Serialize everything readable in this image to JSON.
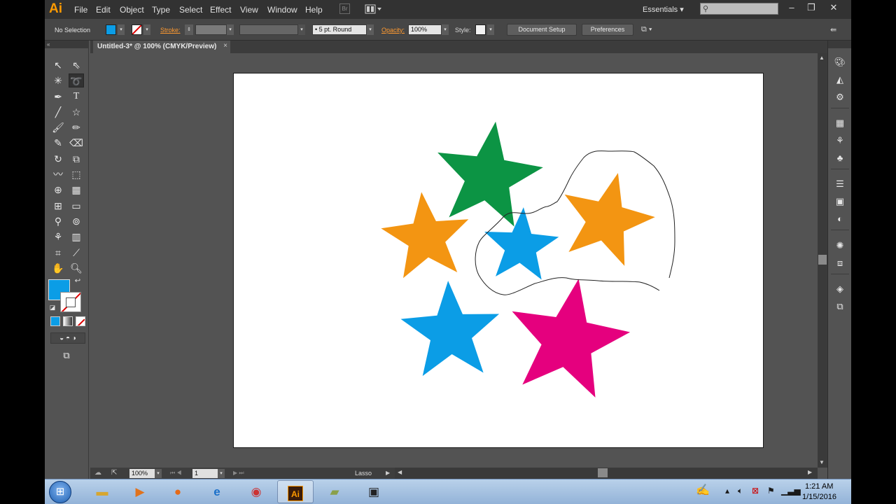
{
  "app": {
    "logo": "Ai",
    "menu": [
      "File",
      "Edit",
      "Object",
      "Type",
      "Select",
      "Effect",
      "View",
      "Window",
      "Help"
    ],
    "bridge_label": "Br",
    "workspace": "Essentials",
    "search_placeholder": ""
  },
  "control_bar": {
    "selection_status": "No Selection",
    "fill_color": "#0b9de6",
    "stroke_label": "Stroke:",
    "brush": "5 pt. Round",
    "opacity_label": "Opacity:",
    "opacity": "100%",
    "style_label": "Style:",
    "document_setup": "Document Setup",
    "preferences": "Preferences"
  },
  "document": {
    "tab_title": "Untitled-3* @ 100% (CMYK/Preview)",
    "close": "×"
  },
  "artwork": {
    "stars": [
      {
        "color": "#0c9444"
      },
      {
        "color": "#f39512"
      },
      {
        "color": "#0b9de6"
      },
      {
        "color": "#f39512"
      },
      {
        "color": "#0b9de6"
      },
      {
        "color": "#e5007e"
      }
    ],
    "lasso_path": "visible"
  },
  "status_bar": {
    "zoom": "100%",
    "artboard": "1",
    "current_tool": "Lasso"
  },
  "tools": {
    "fill_color": "#0b9de6",
    "stroke_color": "none"
  },
  "taskbar": {
    "time": "1:21 AM",
    "date": "1/15/2016"
  }
}
